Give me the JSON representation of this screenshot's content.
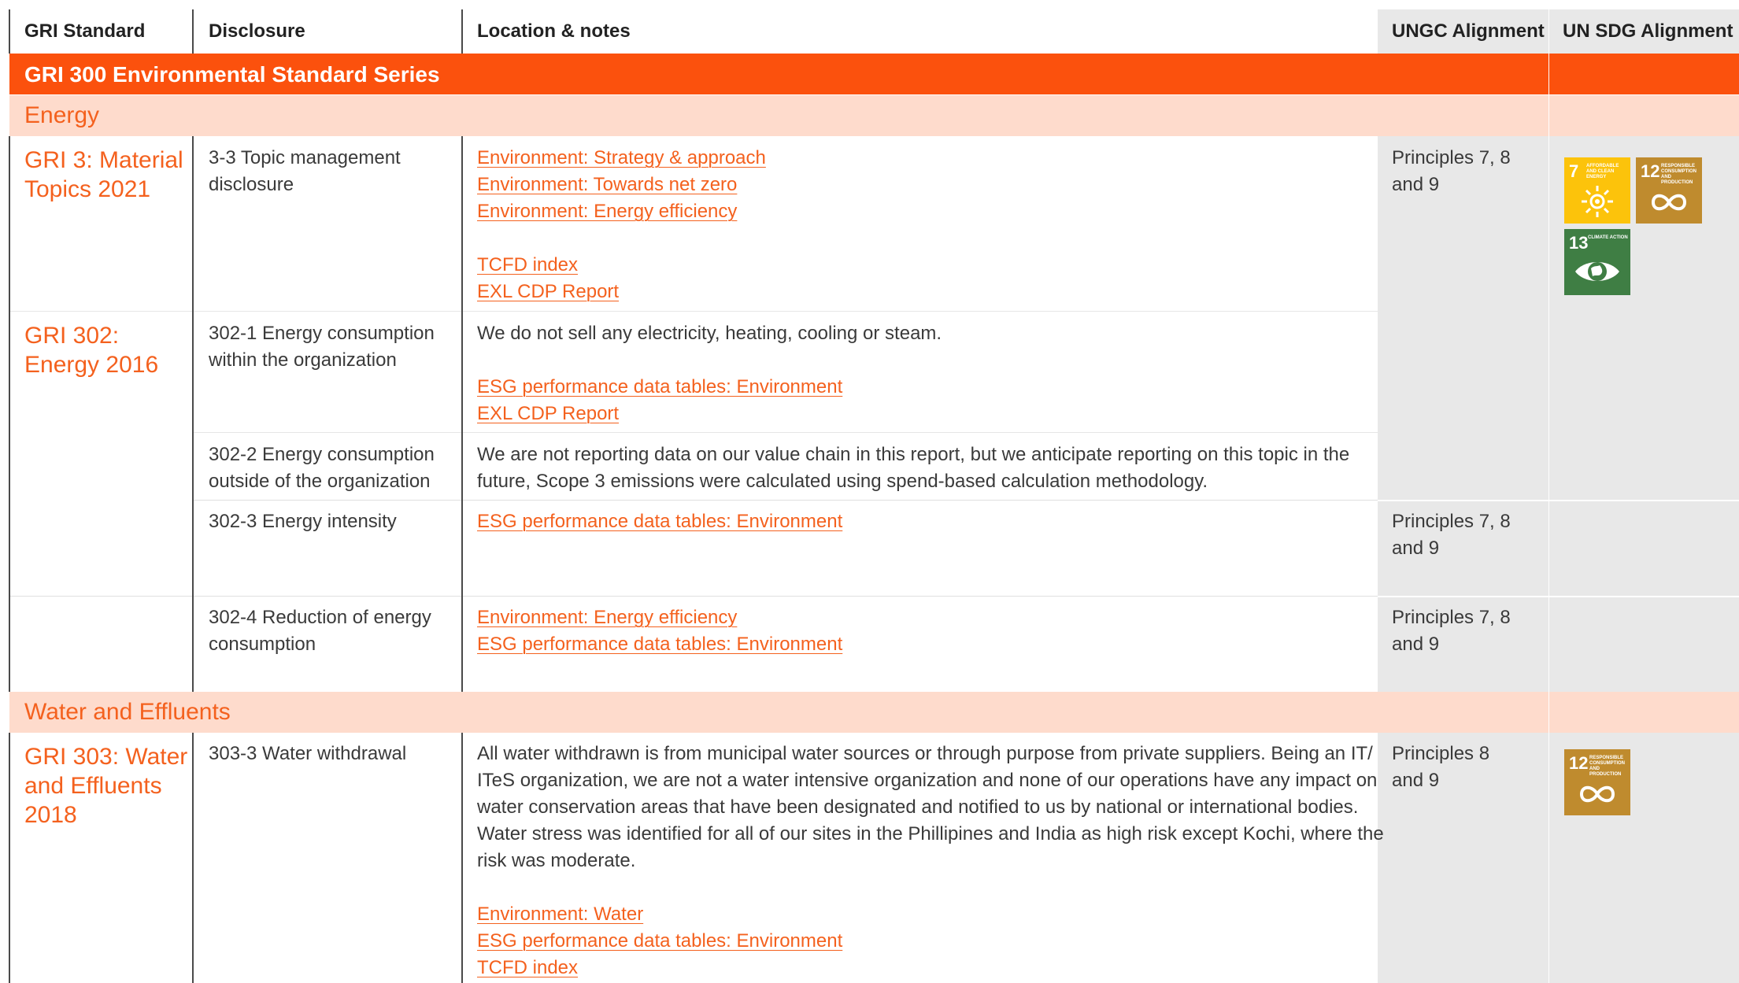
{
  "header": {
    "col1": "GRI Standard",
    "col2": "Disclosure",
    "col3": "Location & notes",
    "col4": "UNGC Alignment",
    "col5": "UN SDG Alignment"
  },
  "series_title": "GRI 300 Environmental Standard Series",
  "sections": {
    "energy": "Energy",
    "water": "Water and Effluents"
  },
  "rows": [
    {
      "standard": [
        "GRI 3: Material",
        "Topics 2021"
      ],
      "disclosure": [
        "3-3 Topic management",
        "disclosure"
      ],
      "links": [
        "Environment: Strategy & approach",
        "Environment: Towards net zero ",
        "Environment: Energy efficiency",
        "TCFD index",
        "EXL CDP Report"
      ],
      "ungc": [
        "Principles 7, 8",
        "and 9"
      ]
    },
    {
      "standard": [
        "GRI 302:",
        "Energy 2016"
      ],
      "disclosure": [
        "302-1 Energy consumption",
        "within the organization"
      ],
      "note": "We do not sell any electricity, heating, cooling or steam.",
      "links": [
        "ESG performance data tables: Environment",
        "EXL CDP Report"
      ]
    },
    {
      "disclosure": [
        "302-2 Energy consumption",
        "outside of the organization"
      ],
      "note": [
        "We are not reporting data on our value chain in this report, but we anticipate reporting on this topic in the",
        "future, Scope 3 emissions were calculated using spend-based calculation methodology."
      ]
    },
    {
      "disclosure": [
        "302-3 Energy intensity"
      ],
      "links": [
        "ESG performance data tables: Environment"
      ],
      "ungc": [
        "Principles 7, 8",
        "and 9"
      ]
    },
    {
      "disclosure": [
        "302-4 Reduction of energy",
        "consumption"
      ],
      "links": [
        "Environment: Energy efficiency",
        "ESG performance data tables: Environment"
      ],
      "ungc": [
        "Principles 7, 8",
        "and 9"
      ]
    },
    {
      "standard": [
        "GRI 303: Water",
        "and Effluents",
        "2018"
      ],
      "disclosure": [
        "303-3 Water withdrawal"
      ],
      "note": [
        "All water withdrawn is from municipal water sources or through purpose from private suppliers. Being an IT/",
        "ITeS organization, we are not a water intensive organization and none of our operations have any impact on",
        "water conservation areas that have been designated and notified to us by national or international bodies.",
        "Water stress was identified for all of our sites in the Phillipines and India as high risk except Kochi, where the",
        "risk was moderate."
      ],
      "links": [
        "Environment: Water ",
        "ESG performance data tables: Environment",
        "TCFD index"
      ],
      "ungc": [
        "Principles 8",
        "and 9"
      ]
    }
  ],
  "sdg_icons": {
    "sdg7": {
      "number": "7",
      "label": "AFFORDABLE AND CLEAN ENERGY",
      "color": "#fcc30b",
      "icon": "sun-icon"
    },
    "sdg12": {
      "number": "12",
      "label": "RESPONSIBLE CONSUMPTION AND PRODUCTION",
      "color": "#bf8b2e",
      "icon": "infinity-icon"
    },
    "sdg13": {
      "number": "13",
      "label": "CLIMATE ACTION",
      "color": "#3f7e44",
      "icon": "earth-eye-icon"
    }
  },
  "colors": {
    "accent": "#fb510d",
    "link": "#f4611e",
    "section_bg": "#fedbcc",
    "alignment_bg": "#e8e8e8"
  }
}
